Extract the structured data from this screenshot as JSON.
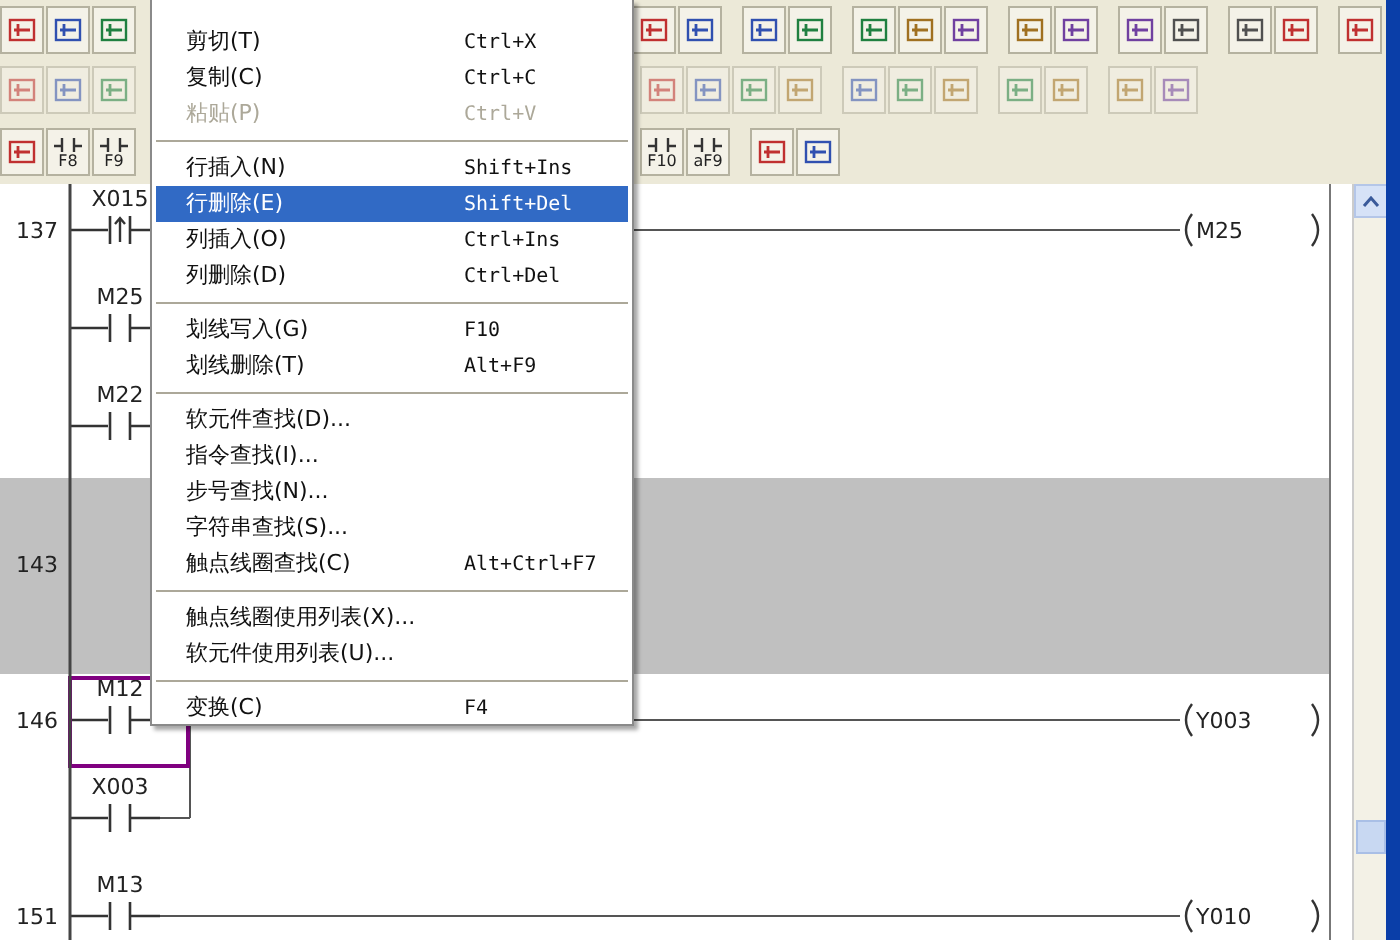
{
  "toolbar": {
    "keys_left": [
      "F8",
      "F9"
    ],
    "keys_right": [
      "F10",
      "aF9"
    ]
  },
  "context_menu": {
    "items": [
      {
        "kind": "item",
        "label": "剪切(T)",
        "shortcut": "Ctrl+X",
        "disabled": false,
        "selected": false
      },
      {
        "kind": "item",
        "label": "复制(C)",
        "shortcut": "Ctrl+C",
        "disabled": false,
        "selected": false
      },
      {
        "kind": "item",
        "label": "粘贴(P)",
        "shortcut": "Ctrl+V",
        "disabled": true,
        "selected": false
      },
      {
        "kind": "separator"
      },
      {
        "kind": "item",
        "label": "行插入(N)",
        "shortcut": "Shift+Ins",
        "disabled": false,
        "selected": false
      },
      {
        "kind": "item",
        "label": "行删除(E)",
        "shortcut": "Shift+Del",
        "disabled": false,
        "selected": true
      },
      {
        "kind": "item",
        "label": "列插入(O)",
        "shortcut": "Ctrl+Ins",
        "disabled": false,
        "selected": false
      },
      {
        "kind": "item",
        "label": "列删除(D)",
        "shortcut": "Ctrl+Del",
        "disabled": false,
        "selected": false
      },
      {
        "kind": "separator"
      },
      {
        "kind": "item",
        "label": "划线写入(G)",
        "shortcut": "F10",
        "disabled": false,
        "selected": false
      },
      {
        "kind": "item",
        "label": "划线删除(T)",
        "shortcut": "Alt+F9",
        "disabled": false,
        "selected": false
      },
      {
        "kind": "separator"
      },
      {
        "kind": "item",
        "label": "软元件查找(D)...",
        "disabled": false,
        "selected": false
      },
      {
        "kind": "item",
        "label": "指令查找(I)...",
        "disabled": false,
        "selected": false
      },
      {
        "kind": "item",
        "label": "步号查找(N)...",
        "disabled": false,
        "selected": false
      },
      {
        "kind": "item",
        "label": "字符串查找(S)...",
        "disabled": false,
        "selected": false
      },
      {
        "kind": "item",
        "label": "触点线圈查找(C)",
        "shortcut": "Alt+Ctrl+F7",
        "disabled": false,
        "selected": false
      },
      {
        "kind": "separator"
      },
      {
        "kind": "item",
        "label": "触点线圈使用列表(X)...",
        "disabled": false,
        "selected": false
      },
      {
        "kind": "item",
        "label": "软元件使用列表(U)...",
        "disabled": false,
        "selected": false
      },
      {
        "kind": "separator"
      },
      {
        "kind": "item",
        "label": "变换(C)",
        "shortcut": "F4",
        "disabled": false,
        "selected": false
      }
    ]
  },
  "ladder": {
    "rungs": [
      {
        "step": "137",
        "selected": false,
        "cursor": false,
        "branches": [
          {
            "contact": {
              "label": "X015",
              "kind": "rising"
            },
            "coil": "M25"
          },
          {
            "contact": {
              "label": "M25",
              "kind": "normal"
            }
          },
          {
            "contact": {
              "label": "M22",
              "kind": "normal"
            }
          }
        ]
      },
      {
        "step": "143",
        "selected": true,
        "cursor": false
      },
      {
        "step": "146",
        "selected": false,
        "cursor": true,
        "branches": [
          {
            "contact": {
              "label": "M12",
              "kind": "normal"
            },
            "coil": "Y003"
          },
          {
            "contact": {
              "label": "X003",
              "kind": "normal"
            }
          }
        ]
      },
      {
        "step": "151",
        "selected": false,
        "cursor": false,
        "branches": [
          {
            "contact": {
              "label": "M13",
              "kind": "normal"
            },
            "coil": "Y010"
          }
        ]
      }
    ]
  }
}
